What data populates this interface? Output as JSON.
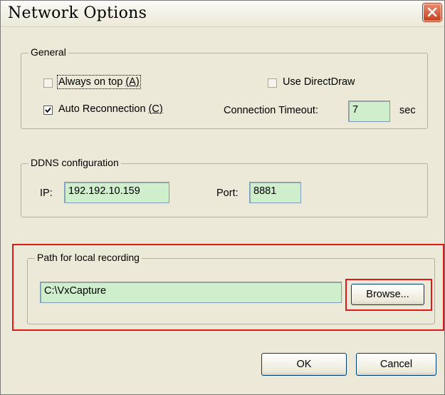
{
  "window": {
    "title": "Network Options"
  },
  "general": {
    "label": "General",
    "always_on_top": {
      "text": "Always on top ",
      "mnemonic": "(A)",
      "checked": false
    },
    "use_directdraw": {
      "label": "Use DirectDraw",
      "checked": false
    },
    "auto_reconnection": {
      "text": "Auto Reconnection ",
      "mnemonic": "(C)",
      "checked": true
    },
    "connection_timeout": {
      "label": "Connection Timeout:",
      "value": "7",
      "unit": "sec"
    }
  },
  "ddns": {
    "label": "DDNS configuration",
    "ip_label": "IP:",
    "ip_value": "192.192.10.159",
    "port_label": "Port:",
    "port_value": "8881"
  },
  "recording": {
    "label": "Path for local recording",
    "path_value": "C:\\VxCapture",
    "browse_label": "Browse..."
  },
  "buttons": {
    "ok": "OK",
    "cancel": "Cancel"
  },
  "colors": {
    "field_bg": "#cfeecc",
    "highlight": "#e01818",
    "dialog_bg": "#ece9d8"
  }
}
